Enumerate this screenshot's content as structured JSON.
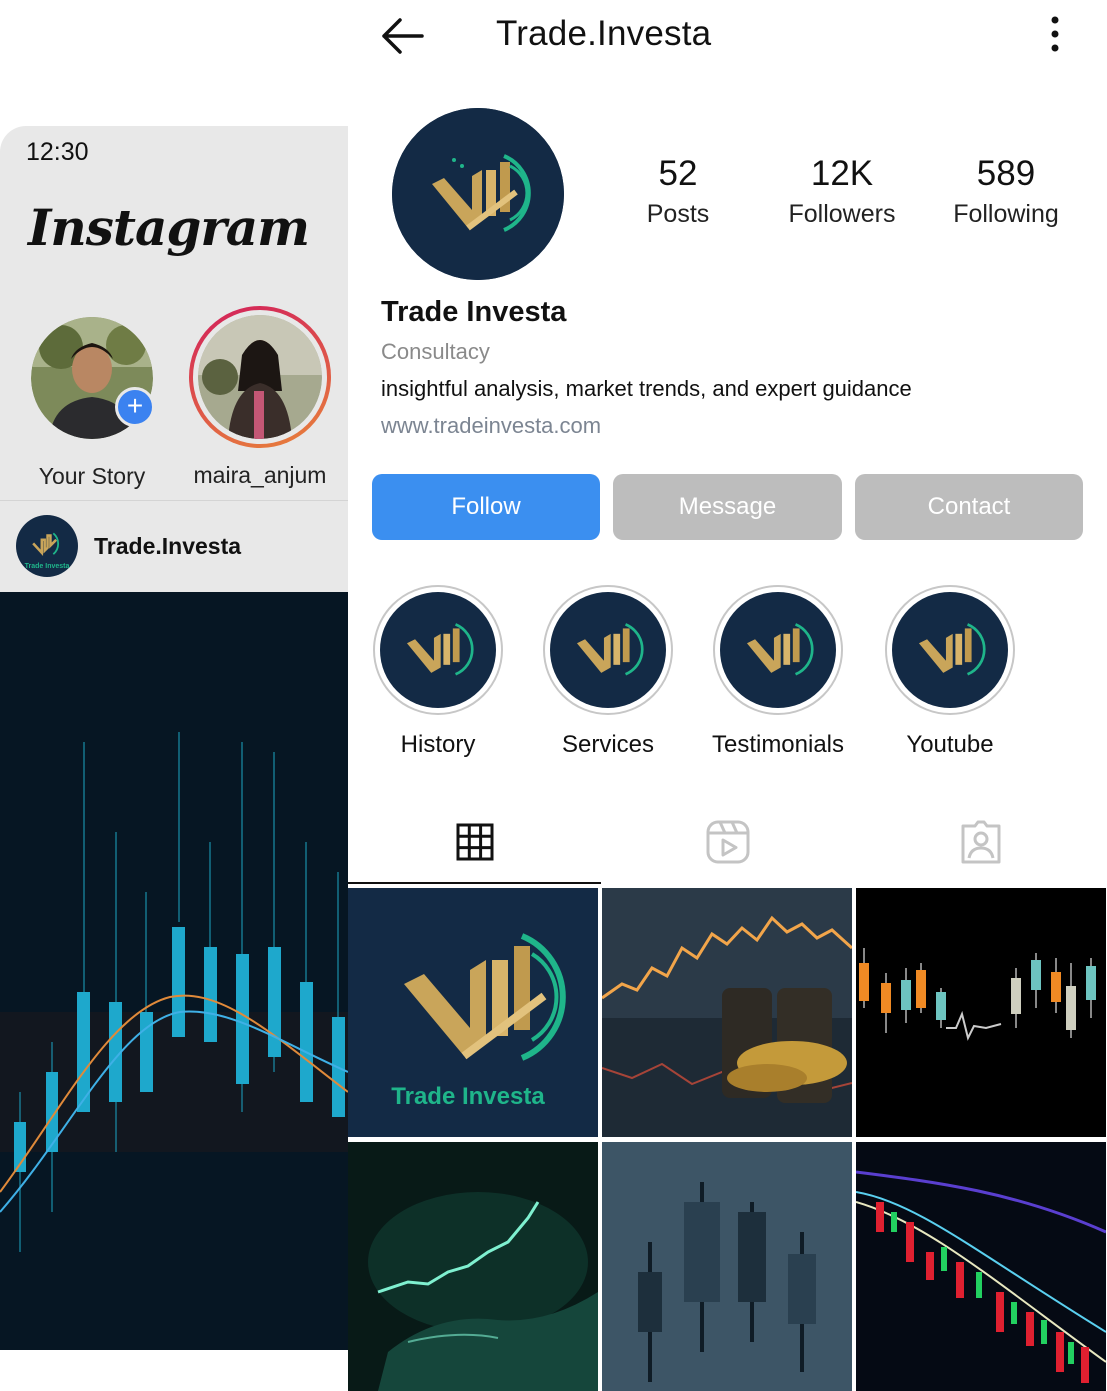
{
  "header": {
    "title": "Trade.Investa",
    "back_icon": "arrow-left-icon",
    "more_icon": "more-vertical-icon"
  },
  "phone": {
    "time": "12:30",
    "app_name": "Instagram",
    "stories": [
      {
        "label": "Your Story"
      },
      {
        "label": "maira_anjum"
      }
    ],
    "post_handle": "Trade.Investa",
    "post_avatar_text": "Trade Investa"
  },
  "profile": {
    "stats": [
      {
        "value": "52",
        "label": "Posts"
      },
      {
        "value": "12K",
        "label": "Followers"
      },
      {
        "value": "589",
        "label": "Following"
      }
    ],
    "name": "Trade Investa",
    "category": "Consultacy",
    "bio": "insightful analysis, market trends, and expert guidance",
    "website": "www.tradeinvesta.com"
  },
  "actions": {
    "follow": "Follow",
    "message": "Message",
    "contact": "Contact"
  },
  "highlights": [
    {
      "label": "History"
    },
    {
      "label": "Services"
    },
    {
      "label": "Testimonials"
    },
    {
      "label": "Youtube"
    }
  ],
  "tabs": [
    {
      "icon": "grid-icon",
      "active": true
    },
    {
      "icon": "reels-icon",
      "active": false
    },
    {
      "icon": "tagged-icon",
      "active": false
    }
  ],
  "grid_posts": [
    {
      "caption": "Trade Investa"
    }
  ],
  "colors": {
    "navy": "#132a45",
    "gold": "#c9a55a",
    "teal": "#1fb58a",
    "follow_blue": "#3b8ff0",
    "gray_button": "#bdbdbd"
  }
}
